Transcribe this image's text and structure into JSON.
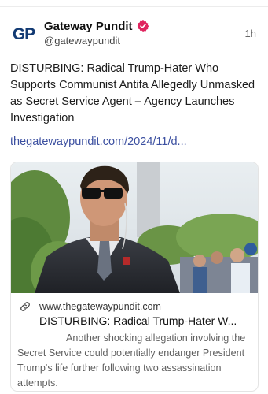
{
  "author": {
    "avatar_text": "GP",
    "display_name": "Gateway Pundit",
    "handle": "@gatewaypundit",
    "verified_icon": "verified-badge-icon",
    "verified_color": "#e0245e"
  },
  "post": {
    "time": "1h",
    "text": "DISTURBING: Radical Trump-Hater Who Supports Communist Antifa Allegedly Unmasked as Secret Service Agent – Agency Launches Investigation",
    "link": "thegatewaypundit.com/2024/11/d...",
    "link_color": "#3b4fa0"
  },
  "card": {
    "link_icon": "link-icon",
    "domain": "www.thegatewaypundit.com",
    "title": "DISTURBING: Radical Trump-Hater W...",
    "description": "Another shocking allegation involving the Secret Service could potentially endanger President Trump's life further following two assassination attempts."
  }
}
